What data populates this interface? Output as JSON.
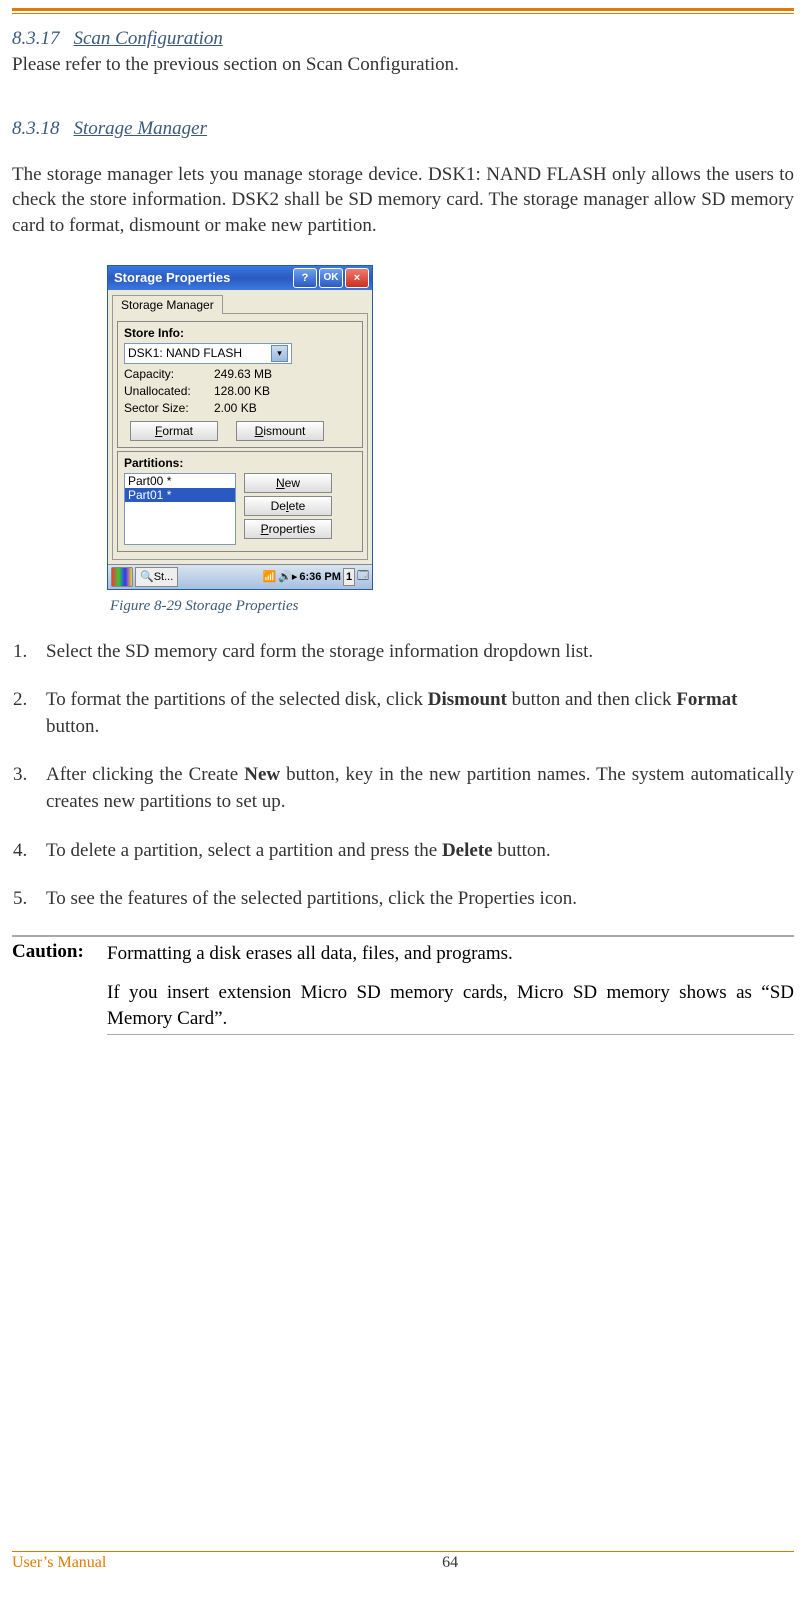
{
  "section1": {
    "num": "8.3.17",
    "title": "Scan Configuration",
    "body": "Please refer to the previous section on Scan Configuration."
  },
  "section2": {
    "num": "8.3.18",
    "title": "Storage Manager",
    "body": "The storage manager lets you manage storage device. DSK1: NAND FLASH only allows the users to check the store information. DSK2 shall be SD memory card. The storage manager allow SD memory card to format, dismount or make new partition."
  },
  "win": {
    "title": "Storage Properties",
    "help": "?",
    "ok": "OK",
    "close": "×",
    "tab": "Storage Manager",
    "storeInfo": "Store Info:",
    "device": "DSK1: NAND FLASH",
    "capacity_lbl": "Capacity:",
    "capacity_val": "249.63 MB",
    "unalloc_lbl": "Unallocated:",
    "unalloc_val": "128.00 KB",
    "sector_lbl": "Sector Size:",
    "sector_val": "2.00 KB",
    "format": "Format",
    "dismount": "Dismount",
    "partitions": "Partitions:",
    "part0": "Part00 *",
    "part1": "Part01 *",
    "new": "New",
    "delete": "Delete",
    "properties": "Properties",
    "task": "St...",
    "time": "6:36 PM",
    "ind": "1"
  },
  "caption": "Figure 8-29 Storage Properties",
  "steps": {
    "s1": "Select the SD memory card form the storage information dropdown list.",
    "s2a": "To format the partitions of the selected disk, click ",
    "s2b": "Dismount",
    "s2c": " button and then click ",
    "s2d": "Format",
    "s2e": " button.",
    "s3a": "After clicking the Create ",
    "s3b": "New",
    "s3c": " button, key in the new partition names. The system automatically creates new partitions to set up.",
    "s4a": "To delete a partition, select a partition and press the ",
    "s4b": "Delete",
    "s4c": "  button.",
    "s5": "To see the features of the selected partitions, click the Properties icon."
  },
  "caution": {
    "label": "Caution:",
    "p1": "Formatting a disk erases all data, files, and programs.",
    "p2": "If you insert extension Micro SD memory cards, Micro SD memory shows as “SD Memory Card”."
  },
  "footer": {
    "left": "User’s Manual",
    "page": "64"
  }
}
